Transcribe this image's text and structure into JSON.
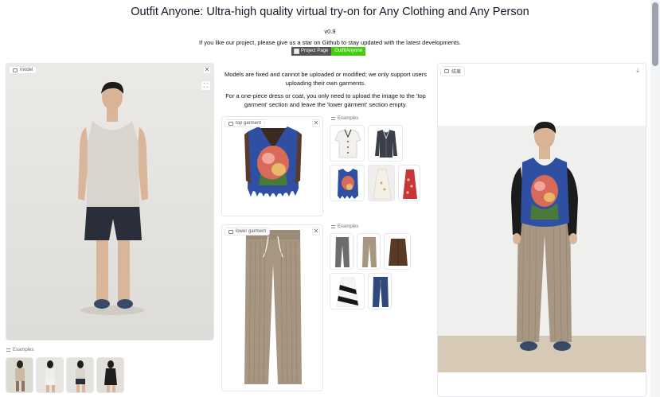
{
  "header": {
    "title": "Outfit Anyone: Ultra-high quality virtual try-on for Any Clothing and Any Person",
    "version": "v0.9",
    "subtitle": "If you like our project, please give us a star on Github to stay updated with the latest developments.",
    "badge_left": "Project Page",
    "badge_right": "OutfitAnyone"
  },
  "model_panel": {
    "label": "model",
    "examples_label": "Examples"
  },
  "notes": {
    "line1": "Models are fixed and cannot be uploaded or modified; we only support users uploading their own garments.",
    "line2": "For a one-piece dress or coat, you only need to upload the image to the 'top garment' section and leave the 'lower garment' section empty."
  },
  "top_garment": {
    "label": "top garment",
    "examples_label": "Examples"
  },
  "lower_garment": {
    "label": "lower garment",
    "examples_label": "Examples"
  },
  "result_panel": {
    "label": "结果"
  },
  "icons": {
    "close": "✕",
    "download": "⤓",
    "expand": "⛶"
  },
  "colors": {
    "accent_green": "#44cc11",
    "badge_gray": "#555555",
    "border": "#e5e7eb"
  }
}
